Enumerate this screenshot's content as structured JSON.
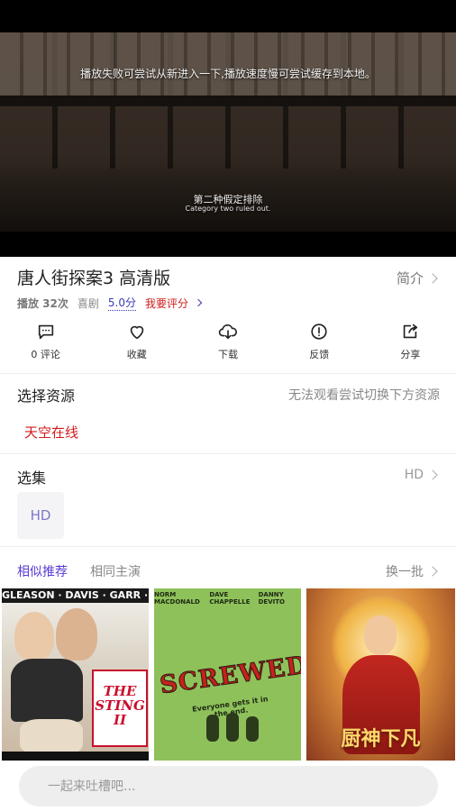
{
  "player": {
    "tip": "播放失败可尝试从新进入一下,播放速度慢可尝试缓存到本地。",
    "subtitle_zh": "第二种假定排除",
    "subtitle_en": "Category two ruled out."
  },
  "video": {
    "title": "唐人街探案3 高清版",
    "intro_label": "简介",
    "plays": "播放 32次",
    "genre": "喜剧",
    "score": "5.0分",
    "rate_label": "我要评分"
  },
  "actions": [
    {
      "icon": "comment-icon",
      "label": "0 评论"
    },
    {
      "icon": "heart-icon",
      "label": "收藏"
    },
    {
      "icon": "cloud-download-icon",
      "label": "下载"
    },
    {
      "icon": "alert-icon",
      "label": "反馈"
    },
    {
      "icon": "share-icon",
      "label": "分享"
    }
  ],
  "source": {
    "title": "选择资源",
    "hint": "无法观看尝试切换下方资源",
    "selected": "天空在线"
  },
  "episodes": {
    "title": "选集",
    "quality": "HD",
    "items": [
      "HD"
    ]
  },
  "recommend": {
    "tab_active": "相似推荐",
    "tab_other": "相同主演",
    "refresh": "换一批",
    "posters": [
      {
        "cast": "GLEASON · DAVIS · GARR · MALDEN · REED",
        "title": "THE STING II"
      },
      {
        "cast": [
          "NORM MACDONALD",
          "DAVE CHAPPELLE",
          "DANNY DEVITO"
        ],
        "title": "SCREWED",
        "tagline": "Everyone gets it in the end."
      },
      {
        "title": "厨神下凡"
      }
    ]
  },
  "comment": {
    "placeholder": "一起来吐槽吧..."
  },
  "colors": {
    "accent_red": "#d21b1b",
    "accent_purple": "#5b3bd6",
    "score_blue": "#3a3ab8"
  }
}
